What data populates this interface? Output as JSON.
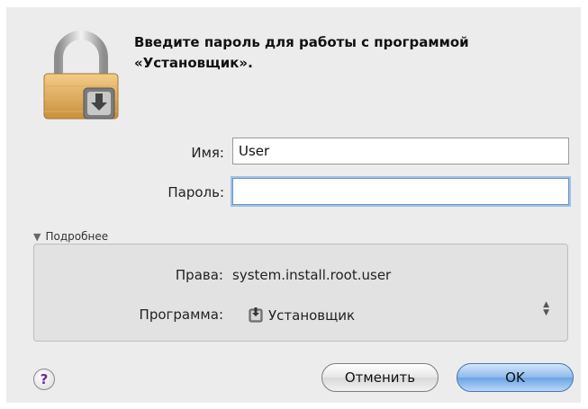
{
  "prompt": {
    "line1": "Введите пароль для работы с программой",
    "line2": "«Установщик»."
  },
  "form": {
    "name_label": "Имя:",
    "name_value": "User",
    "password_label": "Пароль:",
    "password_value": ""
  },
  "details": {
    "toggle_label": "Подробнее",
    "expanded": true,
    "rights_label": "Права:",
    "rights_value": "system.install.root.user",
    "program_label": "Программа:",
    "program_value": "Установщик"
  },
  "buttons": {
    "help_label": "?",
    "cancel_label": "Отменить",
    "ok_label": "OK"
  },
  "icons": {
    "lock": "padlock-icon",
    "program": "installer-icon",
    "toggle": "disclosure-triangle-icon",
    "stepper": "popup-arrows-icon"
  },
  "colors": {
    "dialog_bg": "#ececec",
    "default_button": "#8dbaeb",
    "focus_ring": "#9ec1e8"
  }
}
